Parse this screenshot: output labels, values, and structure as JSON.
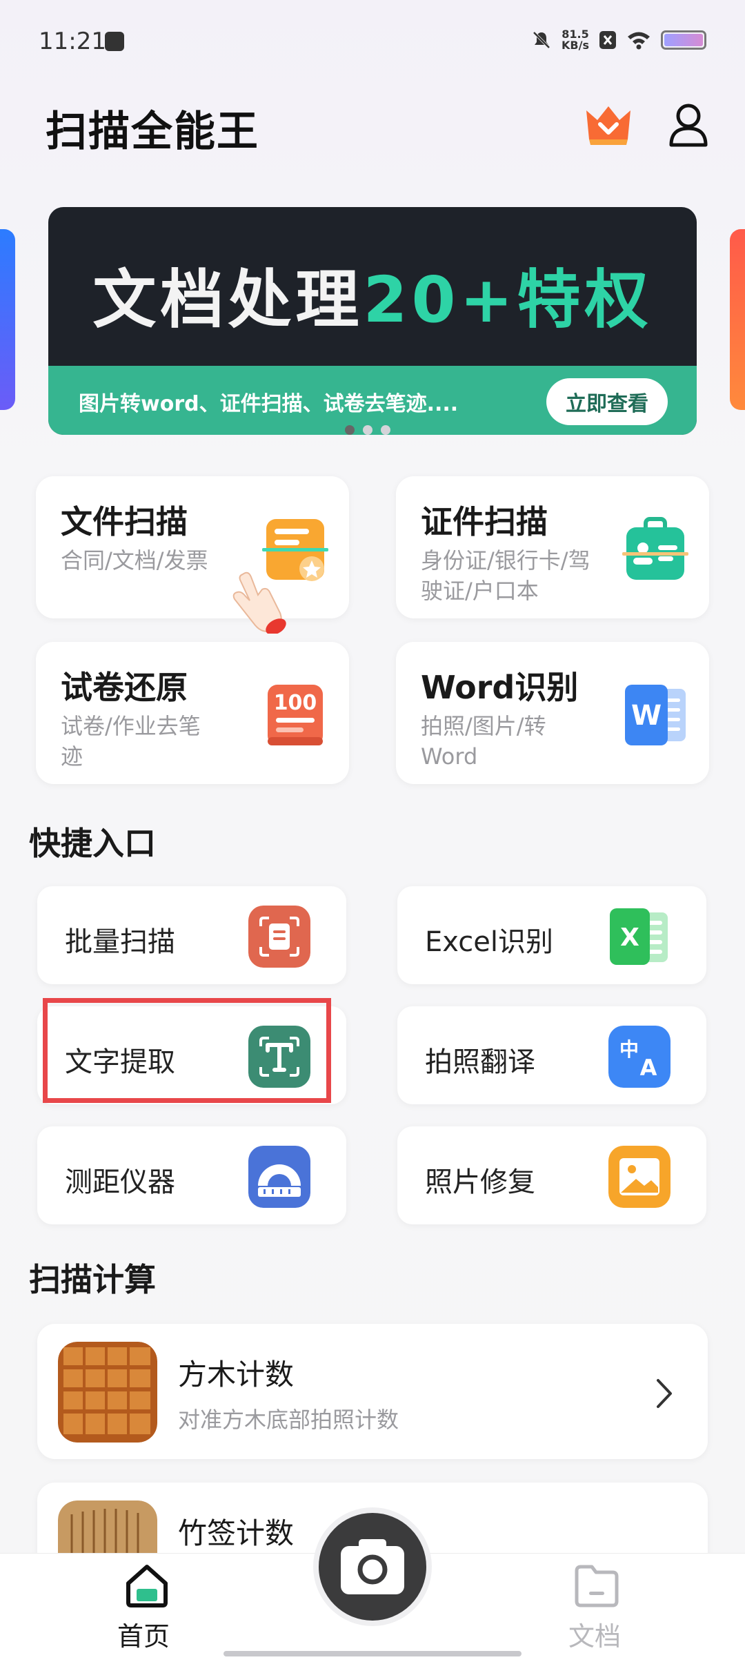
{
  "status_bar": {
    "time": "11:21",
    "speed_value": "81.5",
    "speed_unit": "KB/s"
  },
  "header": {
    "title": "扫描全能王"
  },
  "banner": {
    "title_main": "文档处理",
    "title_highlight": "20+特权",
    "subtitle": "图片转word、证件扫描、试卷去笔迹....",
    "button": "立即查看",
    "active_dot": 0
  },
  "main_features": [
    {
      "title": "文件扫描",
      "subtitle": "合同/文档/发票",
      "icon": "document-scan-icon"
    },
    {
      "title": "证件扫描",
      "subtitle": "身份证/银行卡/驾驶证/户口本",
      "icon": "id-card-scan-icon"
    },
    {
      "title": "试卷还原",
      "subtitle": "试卷/作业去笔迹",
      "icon": "exam-paper-icon"
    },
    {
      "title": "Word识别",
      "subtitle": "拍照/图片/转Word",
      "icon": "word-icon"
    }
  ],
  "quick_section": {
    "title": "快捷入口"
  },
  "quick_entries": [
    {
      "label": "批量扫描",
      "icon": "batch-scan-icon",
      "color": "#e0674f"
    },
    {
      "label": "Excel识别",
      "icon": "excel-icon",
      "color": "#2fbf5b"
    },
    {
      "label": "文字提取",
      "icon": "text-extract-icon",
      "color": "#3c8c73",
      "highlighted": true
    },
    {
      "label": "拍照翻译",
      "icon": "translate-icon",
      "color": "#3d87f5"
    },
    {
      "label": "测距仪器",
      "icon": "ruler-icon",
      "color": "#4a73d8"
    },
    {
      "label": "照片修复",
      "icon": "photo-repair-icon",
      "color": "#f7a52a"
    }
  ],
  "calc_section": {
    "title": "扫描计算"
  },
  "calc_items": [
    {
      "title": "方木计数",
      "subtitle": "对准方木底部拍照计数"
    },
    {
      "title": "竹签计数",
      "subtitle": ""
    }
  ],
  "bottom_nav": {
    "home": "首页",
    "docs": "文档"
  },
  "colors": {
    "accent_green": "#36b590",
    "highlight_red": "#e8474a"
  }
}
